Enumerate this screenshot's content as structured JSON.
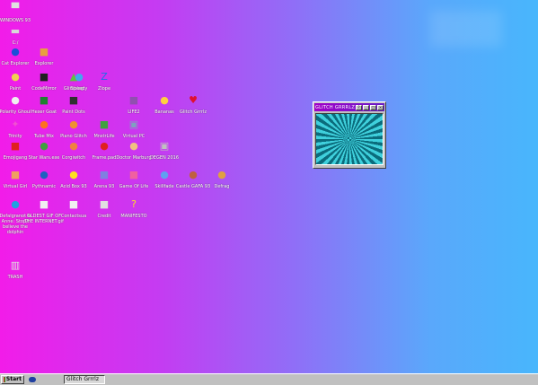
{
  "colors": {
    "bg_left": "#f21ce9",
    "bg_right": "#48b6fc",
    "title_bar": "#a000c8"
  },
  "icons": [
    {
      "label": "WINDOWS 93",
      "icon": "computer-icon",
      "glyph": "▀",
      "color": "#e0e0e0"
    },
    {
      "label": "C:/",
      "icon": "drive-icon",
      "glyph": "▬",
      "color": "#d8d8d8"
    },
    {
      "label": "Cat Explorer",
      "icon": "cat-globe-icon",
      "glyph": "●",
      "color": "#1c4fd8"
    },
    {
      "label": "Explorer",
      "icon": "explorer-icon",
      "glyph": "■",
      "color": "#e8a040"
    },
    {
      "label": "Paint",
      "icon": "paint-palette-icon",
      "glyph": "●",
      "color": "#f0d050"
    },
    {
      "label": "CodeMirror",
      "icon": "code-editor-icon",
      "glyph": "■",
      "color": "#202020"
    },
    {
      "label": "Glitchlog",
      "icon": "glitch-icon",
      "glyph": "▲",
      "color": "#60c040"
    },
    {
      "label": "Speedy",
      "icon": "speedy-icon",
      "glyph": "●",
      "color": "#40a8f0"
    },
    {
      "label": "Zlope",
      "icon": "zlope-icon",
      "glyph": "Z",
      "color": "#1e6ee8"
    },
    {
      "label": "Polarity Ghoul",
      "icon": "ghost-icon",
      "glyph": "●",
      "color": "#f0f0f0"
    },
    {
      "label": "Hexer Goat",
      "icon": "goat-icon",
      "glyph": "■",
      "color": "#208030"
    },
    {
      "label": "Paint Dots",
      "icon": "dots-icon",
      "glyph": "■",
      "color": "#303030"
    },
    {
      "label": "LIFE2",
      "icon": "life2-icon",
      "glyph": "■",
      "color": "#9050b0"
    },
    {
      "label": "Bananas",
      "icon": "banana-icon",
      "glyph": "●",
      "color": "#ffd040"
    },
    {
      "label": "Glitch Grrrlz",
      "icon": "heart-icon",
      "glyph": "♥",
      "color": "#e01030"
    },
    {
      "label": "Trinity",
      "icon": "trinity-icon",
      "glyph": "✦",
      "color": "#f050d0"
    },
    {
      "label": "Tube Mix",
      "icon": "tube-icon",
      "glyph": "●",
      "color": "#ff7020"
    },
    {
      "label": "Piano Glitch",
      "icon": "piano-icon",
      "glyph": "●",
      "color": "#f09030"
    },
    {
      "label": "MnstrLife",
      "icon": "monster-icon",
      "glyph": "■",
      "color": "#40a040"
    },
    {
      "label": "Virtual PC",
      "icon": "virtual-pc-icon",
      "glyph": "▣",
      "color": "#80a0c0"
    },
    {
      "label": "Emojigang",
      "icon": "emoji-icon",
      "glyph": "■",
      "color": "#e02020"
    },
    {
      "label": "Star Wars.exe",
      "icon": "yoda-icon",
      "glyph": "●",
      "color": "#40a040"
    },
    {
      "label": "Corgiwitch",
      "icon": "corgi-icon",
      "glyph": "●",
      "color": "#f08040"
    },
    {
      "label": "Frame.pad",
      "icon": "mushroom-icon",
      "glyph": "●",
      "color": "#e02020"
    },
    {
      "label": "Doctor Marburg",
      "icon": "doctor-icon",
      "glyph": "●",
      "color": "#f0c080"
    },
    {
      "label": "DEGEN 2016",
      "icon": "monitor-icon",
      "glyph": "▣",
      "color": "#c0c0c0"
    },
    {
      "label": "Virtual Girl",
      "icon": "virtual-girl-icon",
      "glyph": "■",
      "color": "#f0a060"
    },
    {
      "label": "Pythnamic",
      "icon": "python-icon",
      "glyph": "●",
      "color": "#2060c0"
    },
    {
      "label": "Acid Box 93",
      "icon": "acid-icon",
      "glyph": "●",
      "color": "#ffe020"
    },
    {
      "label": "Arena 93",
      "icon": "cube-icon",
      "glyph": "■",
      "color": "#8080e0"
    },
    {
      "label": "Game Of Life",
      "icon": "game-of-life-icon",
      "glyph": "■",
      "color": "#f060a0"
    },
    {
      "label": "Skillfade",
      "icon": "skull-icon",
      "glyph": "●",
      "color": "#60a0f0"
    },
    {
      "label": "Castle GAFA 93",
      "icon": "castle-icon",
      "glyph": "●",
      "color": "#c06040"
    },
    {
      "label": "Defrag",
      "icon": "defrag-icon",
      "glyph": "●",
      "color": "#e0a040"
    },
    {
      "label": "Defalgranot & Anne: Stop/I believe the dolphin",
      "icon": "dolphin-icon",
      "glyph": "●",
      "color": "#20a0e0"
    },
    {
      "label": "OLDEST GIF OF THE INTERNET.gif",
      "icon": "gif-icon",
      "glyph": "■",
      "color": "#f0f0f0"
    },
    {
      "label": "Contactsua",
      "icon": "contacts-icon",
      "glyph": "■",
      "color": "#f0f0f0"
    },
    {
      "label": "Credit",
      "icon": "credits-icon",
      "glyph": "■",
      "color": "#e0e0e0"
    },
    {
      "label": "MANIFESTO",
      "icon": "question-icon",
      "glyph": "?",
      "color": "#ffe020"
    },
    {
      "label": "TRASH",
      "icon": "trash-icon",
      "glyph": "▥",
      "color": "#e0e0e0"
    }
  ],
  "window": {
    "title": "GLITCH GRRRLZ",
    "btn_help": "?",
    "btn_min": "_",
    "btn_max": "□",
    "btn_close": "×"
  },
  "taskbar": {
    "start_label": "Start",
    "task_label": "Glitch Grrrlz"
  }
}
